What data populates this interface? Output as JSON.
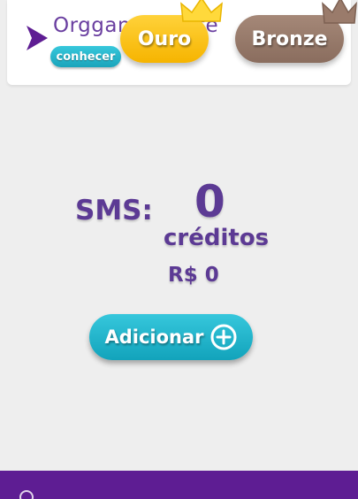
{
  "header": {
    "brand": "Orggan",
    "brand_suffix": "ite",
    "conhecer_label": "conhecer"
  },
  "plans": {
    "gold": "Ouro",
    "bronze": "Bronze"
  },
  "balance": {
    "label": "SMS:",
    "credits": "0",
    "credits_word": "créditos",
    "price": "R$ 0"
  },
  "actions": {
    "add_label": "Adicionar"
  },
  "colors": {
    "primary_purple": "#5c3a94",
    "accent_teal": "#1aa4bb",
    "gold": "#f6b400",
    "bronze": "#8a6d5e",
    "bottom_bar": "#5e1d93"
  }
}
